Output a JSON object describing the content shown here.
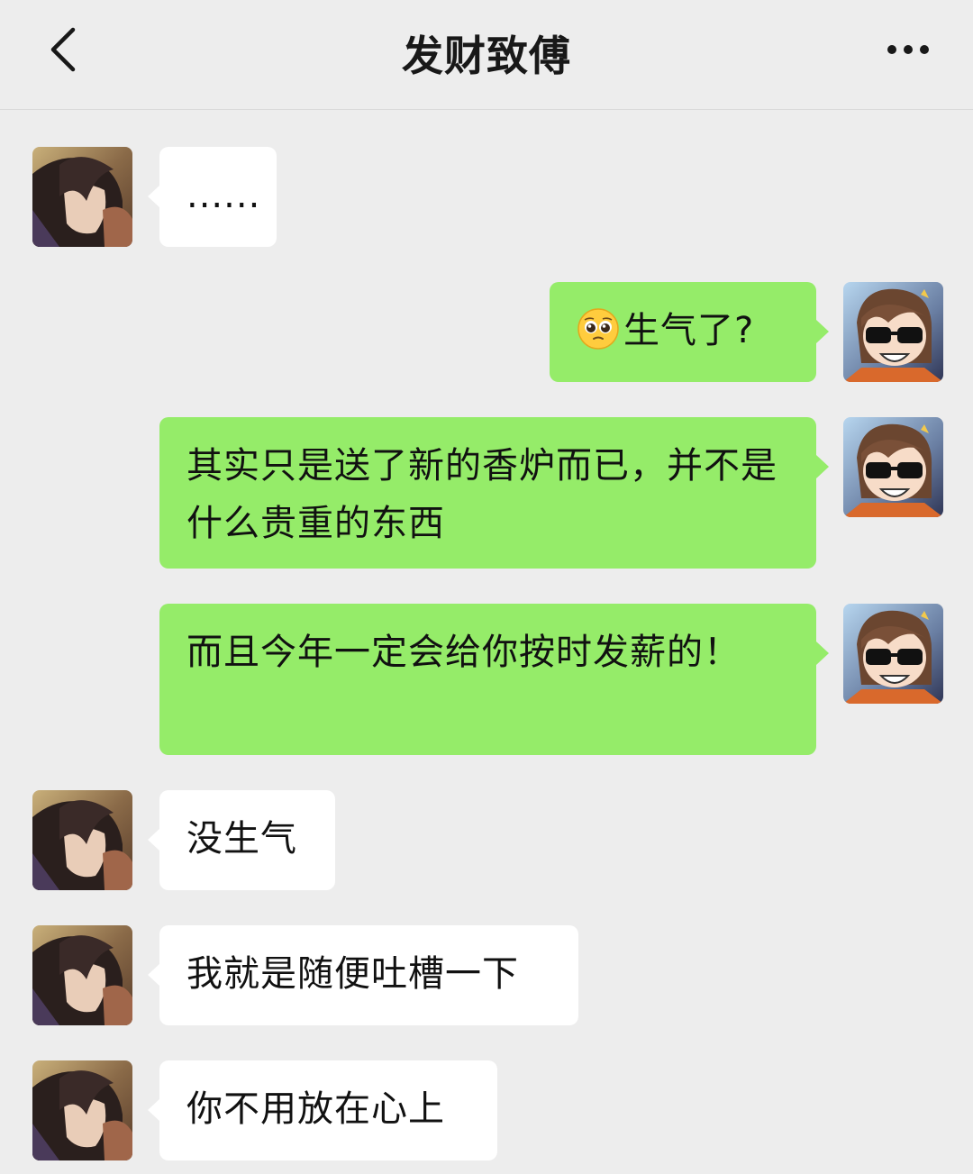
{
  "header": {
    "title": "发财致傅",
    "back_icon": "chevron-left-icon",
    "more_icon": "more-dots-icon"
  },
  "contacts": {
    "other": {
      "avatar": "anime-man-dark-hair-avatar"
    },
    "self": {
      "avatar": "chibi-sunglasses-avatar"
    }
  },
  "colors": {
    "incoming": "#ffffff",
    "outgoing": "#95ec69",
    "background": "#ededed"
  },
  "messages": [
    {
      "from": "other",
      "text": "......"
    },
    {
      "from": "self",
      "emoji": "pleading-face-emoji",
      "text": "生气了?"
    },
    {
      "from": "self",
      "text": "其实只是送了新的香炉而已，并不是什么贵重的东西"
    },
    {
      "from": "self",
      "text": "而且今年一定会给你按时发薪的！"
    },
    {
      "from": "other",
      "text": "没生气"
    },
    {
      "from": "other",
      "text": "我就是随便吐槽一下"
    },
    {
      "from": "other",
      "text": "你不用放在心上"
    }
  ]
}
